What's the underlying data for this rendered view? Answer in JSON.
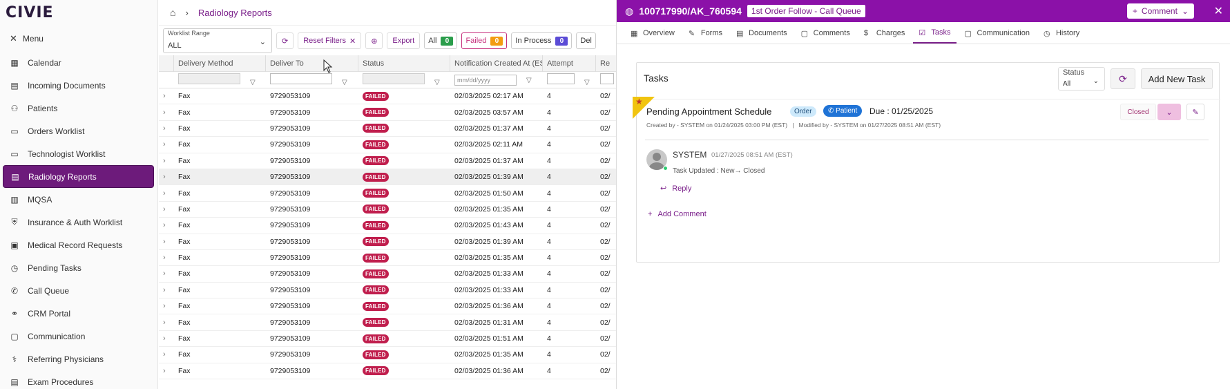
{
  "logo": "CIVIE",
  "sidebar": {
    "menu_label": "Menu",
    "items": [
      {
        "label": "Calendar",
        "icon": "calendar-icon"
      },
      {
        "label": "Incoming Documents",
        "icon": "document-icon"
      },
      {
        "label": "Patients",
        "icon": "users-icon"
      },
      {
        "label": "Orders Worklist",
        "icon": "monitor-icon"
      },
      {
        "label": "Technologist Worklist",
        "icon": "monitor-icon"
      },
      {
        "label": "Radiology Reports",
        "icon": "report-icon",
        "active": true
      },
      {
        "label": "MQSA",
        "icon": "clipboard-icon"
      },
      {
        "label": "Insurance & Auth Worklist",
        "icon": "shield-icon"
      },
      {
        "label": "Medical Record Requests",
        "icon": "folder-icon"
      },
      {
        "label": "Pending Tasks",
        "icon": "clock-icon"
      },
      {
        "label": "Call Queue",
        "icon": "phone-icon"
      },
      {
        "label": "CRM Portal",
        "icon": "handshake-icon"
      },
      {
        "label": "Communication",
        "icon": "chat-icon"
      },
      {
        "label": "Referring Physicians",
        "icon": "stethoscope-icon"
      },
      {
        "label": "Exam Procedures",
        "icon": "file-icon"
      }
    ]
  },
  "header": {
    "breadcrumb": "Radiology Reports"
  },
  "toolbar": {
    "worklist_range_label": "Worklist Range",
    "worklist_range_value": "ALL",
    "reset_filters": "Reset Filters",
    "export": "Export",
    "counts": [
      {
        "label": "All",
        "count": "0",
        "color": "#2a9d4b"
      },
      {
        "label": "Failed",
        "count": "0",
        "color": "#f39c12"
      },
      {
        "label": "In Process",
        "count": "0",
        "color": "#5b4cd6"
      },
      {
        "label": "Del",
        "count": "",
        "color": ""
      }
    ]
  },
  "grid": {
    "columns": [
      "Delivery Method",
      "Deliver To",
      "Status",
      "Notification Created At (EST)",
      "Attempt",
      "Re"
    ],
    "date_placeholder": "mm/dd/yyyy",
    "rows": [
      {
        "method": "Fax",
        "to": "9729053109",
        "status": "FAILED",
        "created": "02/03/2025 02:17 AM",
        "attempt": "4",
        "re": "02/"
      },
      {
        "method": "Fax",
        "to": "9729053109",
        "status": "FAILED",
        "created": "02/03/2025 03:57 AM",
        "attempt": "4",
        "re": "02/"
      },
      {
        "method": "Fax",
        "to": "9729053109",
        "status": "FAILED",
        "created": "02/03/2025 01:37 AM",
        "attempt": "4",
        "re": "02/"
      },
      {
        "method": "Fax",
        "to": "9729053109",
        "status": "FAILED",
        "created": "02/03/2025 02:11 AM",
        "attempt": "4",
        "re": "02/"
      },
      {
        "method": "Fax",
        "to": "9729053109",
        "status": "FAILED",
        "created": "02/03/2025 01:37 AM",
        "attempt": "4",
        "re": "02/"
      },
      {
        "method": "Fax",
        "to": "9729053109",
        "status": "FAILED",
        "created": "02/03/2025 01:39 AM",
        "attempt": "4",
        "re": "02/"
      },
      {
        "method": "Fax",
        "to": "9729053109",
        "status": "FAILED",
        "created": "02/03/2025 01:50 AM",
        "attempt": "4",
        "re": "02/"
      },
      {
        "method": "Fax",
        "to": "9729053109",
        "status": "FAILED",
        "created": "02/03/2025 01:35 AM",
        "attempt": "4",
        "re": "02/"
      },
      {
        "method": "Fax",
        "to": "9729053109",
        "status": "FAILED",
        "created": "02/03/2025 01:43 AM",
        "attempt": "4",
        "re": "02/"
      },
      {
        "method": "Fax",
        "to": "9729053109",
        "status": "FAILED",
        "created": "02/03/2025 01:39 AM",
        "attempt": "4",
        "re": "02/"
      },
      {
        "method": "Fax",
        "to": "9729053109",
        "status": "FAILED",
        "created": "02/03/2025 01:35 AM",
        "attempt": "4",
        "re": "02/"
      },
      {
        "method": "Fax",
        "to": "9729053109",
        "status": "FAILED",
        "created": "02/03/2025 01:33 AM",
        "attempt": "4",
        "re": "02/"
      },
      {
        "method": "Fax",
        "to": "9729053109",
        "status": "FAILED",
        "created": "02/03/2025 01:33 AM",
        "attempt": "4",
        "re": "02/"
      },
      {
        "method": "Fax",
        "to": "9729053109",
        "status": "FAILED",
        "created": "02/03/2025 01:36 AM",
        "attempt": "4",
        "re": "02/"
      },
      {
        "method": "Fax",
        "to": "9729053109",
        "status": "FAILED",
        "created": "02/03/2025 01:31 AM",
        "attempt": "4",
        "re": "02/"
      },
      {
        "method": "Fax",
        "to": "9729053109",
        "status": "FAILED",
        "created": "02/03/2025 01:51 AM",
        "attempt": "4",
        "re": "02/"
      },
      {
        "method": "Fax",
        "to": "9729053109",
        "status": "FAILED",
        "created": "02/03/2025 01:35 AM",
        "attempt": "4",
        "re": "02/"
      },
      {
        "method": "Fax",
        "to": "9729053109",
        "status": "FAILED",
        "created": "02/03/2025 01:36 AM",
        "attempt": "4",
        "re": "02/"
      }
    ]
  },
  "panel": {
    "id": "100717990/AK_760594",
    "queue_label": "1st Order Follow - Call Queue",
    "comment_btn": "Comment",
    "tabs": [
      {
        "label": "Overview",
        "icon": "grid-icon"
      },
      {
        "label": "Forms",
        "icon": "form-icon"
      },
      {
        "label": "Documents",
        "icon": "document-icon"
      },
      {
        "label": "Comments",
        "icon": "comment-icon"
      },
      {
        "label": "Charges",
        "icon": "dollar-icon"
      },
      {
        "label": "Tasks",
        "icon": "tasks-icon",
        "active": true
      },
      {
        "label": "Communication",
        "icon": "chat-icon"
      },
      {
        "label": "History",
        "icon": "history-icon"
      }
    ],
    "tasks": {
      "title": "Tasks",
      "status_label": "Status",
      "status_value": "All",
      "add_button": "Add New Task",
      "item": {
        "name": "Pending Appointment Schedule",
        "chip_order": "Order",
        "chip_patient": "Patient",
        "due": "Due : 01/25/2025",
        "created": "Created by - SYSTEM on 01/24/2025 03:00 PM (EST)",
        "separator": "|",
        "modified": "Modified by - SYSTEM on 01/27/2025 08:51 AM (EST)",
        "status": "Closed",
        "comment": {
          "author": "SYSTEM",
          "time": "01/27/2025 08:51 AM (EST)",
          "text": "Task Updated : New→ Closed"
        },
        "reply": "Reply",
        "add_comment": "Add Comment"
      }
    }
  }
}
